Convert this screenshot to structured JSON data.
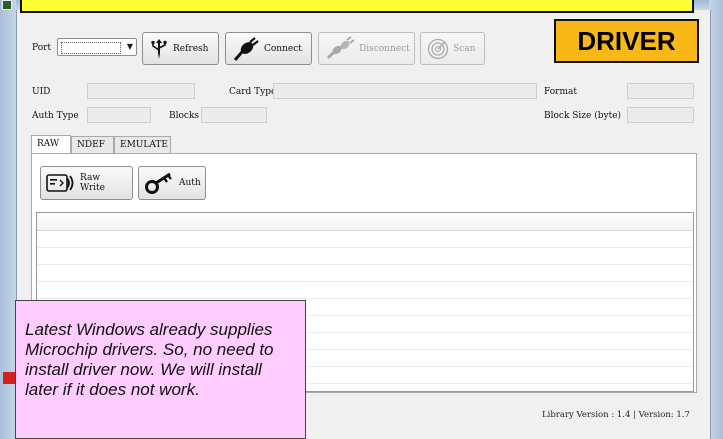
{
  "toolbar": {
    "port_label": "Port",
    "refresh_label": "Refresh",
    "connect_label": "Connect",
    "disconnect_label": "Disconnect",
    "scan_label": "Scan"
  },
  "info": {
    "uid_label": "UID",
    "card_type_label": "Card Type",
    "format_label": "Format",
    "auth_type_label": "Auth Type",
    "blocks_label": "Blocks",
    "block_size_label": "Block Size (byte)"
  },
  "tabs": [
    {
      "label": "RAW"
    },
    {
      "label": "NDEF"
    },
    {
      "label": "EMULATE"
    }
  ],
  "raw_panel": {
    "raw_write_label": "Raw Write",
    "auth_label": "Auth"
  },
  "status_bar": {
    "version_text": "Library Version : 1.4 | Version: 1.7"
  },
  "annotations": {
    "driver_label": "DRIVER",
    "note_text": "Latest Windows already supplies Microchip drivers. So, no need to install driver now. We will install later if it does not work."
  },
  "colors": {
    "banner": "#ffff33",
    "driver_label_bg": "#f9b817",
    "note_bg": "#ffccff"
  }
}
